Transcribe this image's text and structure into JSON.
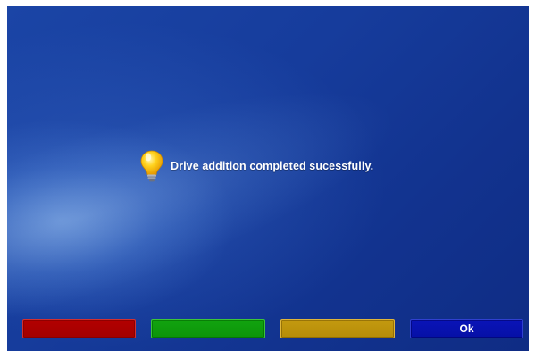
{
  "dialog": {
    "message": "Drive addition completed sucessfully.",
    "icon": "lightbulb-icon"
  },
  "buttons": {
    "red": {
      "label": "",
      "color": "#b30000"
    },
    "green": {
      "label": "",
      "color": "#12a40f"
    },
    "yellow": {
      "label": "",
      "color": "#c49a10"
    },
    "blue": {
      "label": "Ok",
      "color": "#0a14b8"
    }
  },
  "colors": {
    "background": "#133593",
    "text": "#ffffff"
  }
}
